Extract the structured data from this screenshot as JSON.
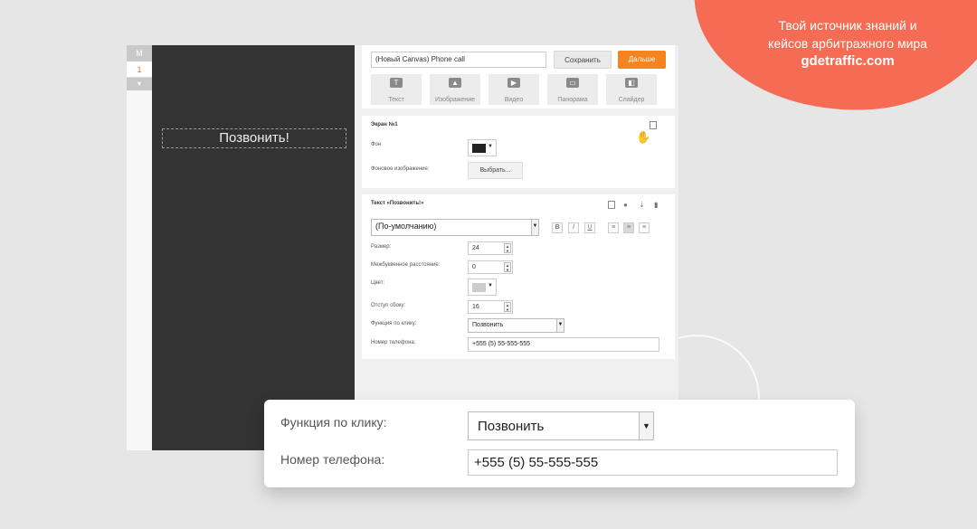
{
  "promo": {
    "line1": "Твой источник знаний и",
    "line2": "кейсов арбитражного мира",
    "brand": "gdetraffic.com"
  },
  "colors": {
    "accent": "#f5831f",
    "promo_bg": "#f56b53",
    "preview_bg": "#333333"
  },
  "pager": {
    "m_label": "M",
    "page1": "1",
    "add": "▾"
  },
  "preview": {
    "button_text": "Позвонить!"
  },
  "toolbar": {
    "project_title": "(Новый Canvas) Phone call",
    "save_label": "Сохранить",
    "next_label": "Дальше",
    "tools": [
      {
        "label": "Текст",
        "icon": "text-icon"
      },
      {
        "label": "Изображение",
        "icon": "image-icon"
      },
      {
        "label": "Видео",
        "icon": "video-icon"
      },
      {
        "label": "Панорама",
        "icon": "panorama-icon"
      },
      {
        "label": "Слайдер",
        "icon": "slider-icon"
      }
    ]
  },
  "screen": {
    "title": "Экран №1",
    "bg_label": "Фон",
    "bg_color": "#222222",
    "bg_image_label": "Фоновое изображение:",
    "choose_label": "Выбрать..."
  },
  "text_block": {
    "title": "Текст «Позвонить!»",
    "font_value": "(По-умолчанию)",
    "fmt_bold": "B",
    "fmt_italic": "I",
    "fmt_underline": "U",
    "size_label": "Размер:",
    "size_value": "24",
    "spacing_label": "Межбуквенное расстояние:",
    "spacing_value": "0",
    "color_label": "Цвет:",
    "text_color": "#cccccc",
    "padding_label": "Отступ сбоку:",
    "padding_value": "16",
    "click_label": "Функция по клику:",
    "click_value": "Позвонить",
    "phone_label": "Номер телефона:",
    "phone_value": "+555 (5) 55-555-555"
  },
  "zoom": {
    "click_label": "Функция по клику:",
    "click_value": "Позвонить",
    "phone_label": "Номер телефона:",
    "phone_value": "+555 (5) 55-555-555"
  }
}
